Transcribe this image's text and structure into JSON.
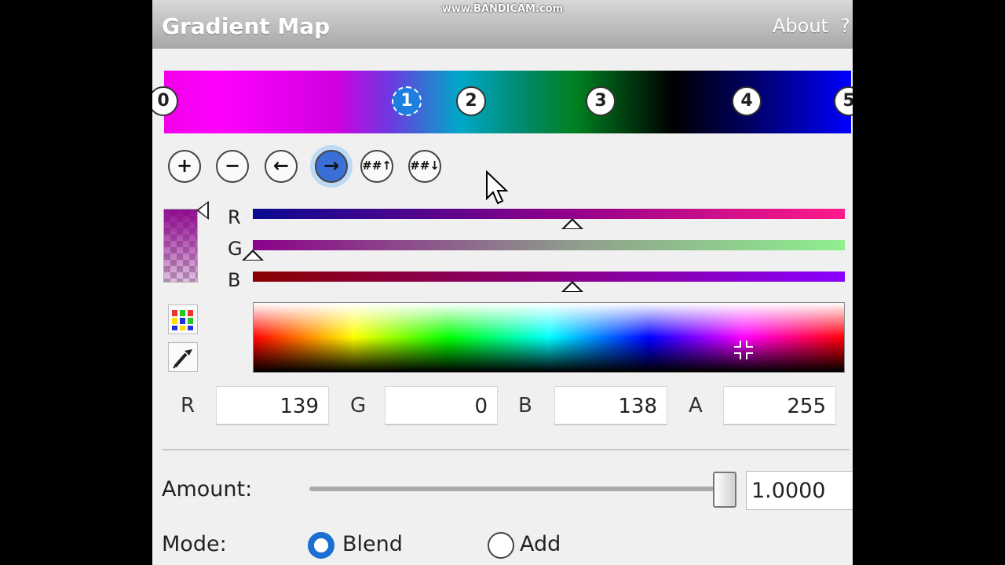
{
  "watermark": "www.BANDICAM.com",
  "window": {
    "title": "Gradient Map",
    "about": "About",
    "help": "?"
  },
  "gradient": {
    "stops": [
      {
        "label": "0",
        "selected": false
      },
      {
        "label": "1",
        "selected": true
      },
      {
        "label": "2",
        "selected": false
      },
      {
        "label": "3",
        "selected": false
      },
      {
        "label": "4",
        "selected": false
      },
      {
        "label": "5",
        "selected": false
      }
    ]
  },
  "toolbar": {
    "buttons": [
      {
        "icon": "plus-icon",
        "glyph": "+"
      },
      {
        "icon": "minus-icon",
        "glyph": "−"
      },
      {
        "icon": "arrow-left-icon",
        "glyph": "←"
      },
      {
        "icon": "arrow-right-icon",
        "glyph": "→",
        "active": true
      },
      {
        "icon": "distribute-up-icon",
        "glyph": "##↑"
      },
      {
        "icon": "distribute-down-icon",
        "glyph": "##↓"
      }
    ]
  },
  "channels": {
    "r": {
      "label": "R",
      "level": 0.54
    },
    "g": {
      "label": "G",
      "level": 0.0
    },
    "b": {
      "label": "B",
      "level": 0.54
    }
  },
  "values": {
    "r_label": "R",
    "r": "139",
    "g_label": "G",
    "g": "0",
    "b_label": "B",
    "b": "138",
    "a_label": "A",
    "a": "255"
  },
  "amount": {
    "label": "Amount:",
    "value": "1.0000",
    "level": 1.0
  },
  "mode": {
    "label": "Mode:",
    "options": [
      "Blend",
      "Add"
    ],
    "selected": "Blend"
  }
}
